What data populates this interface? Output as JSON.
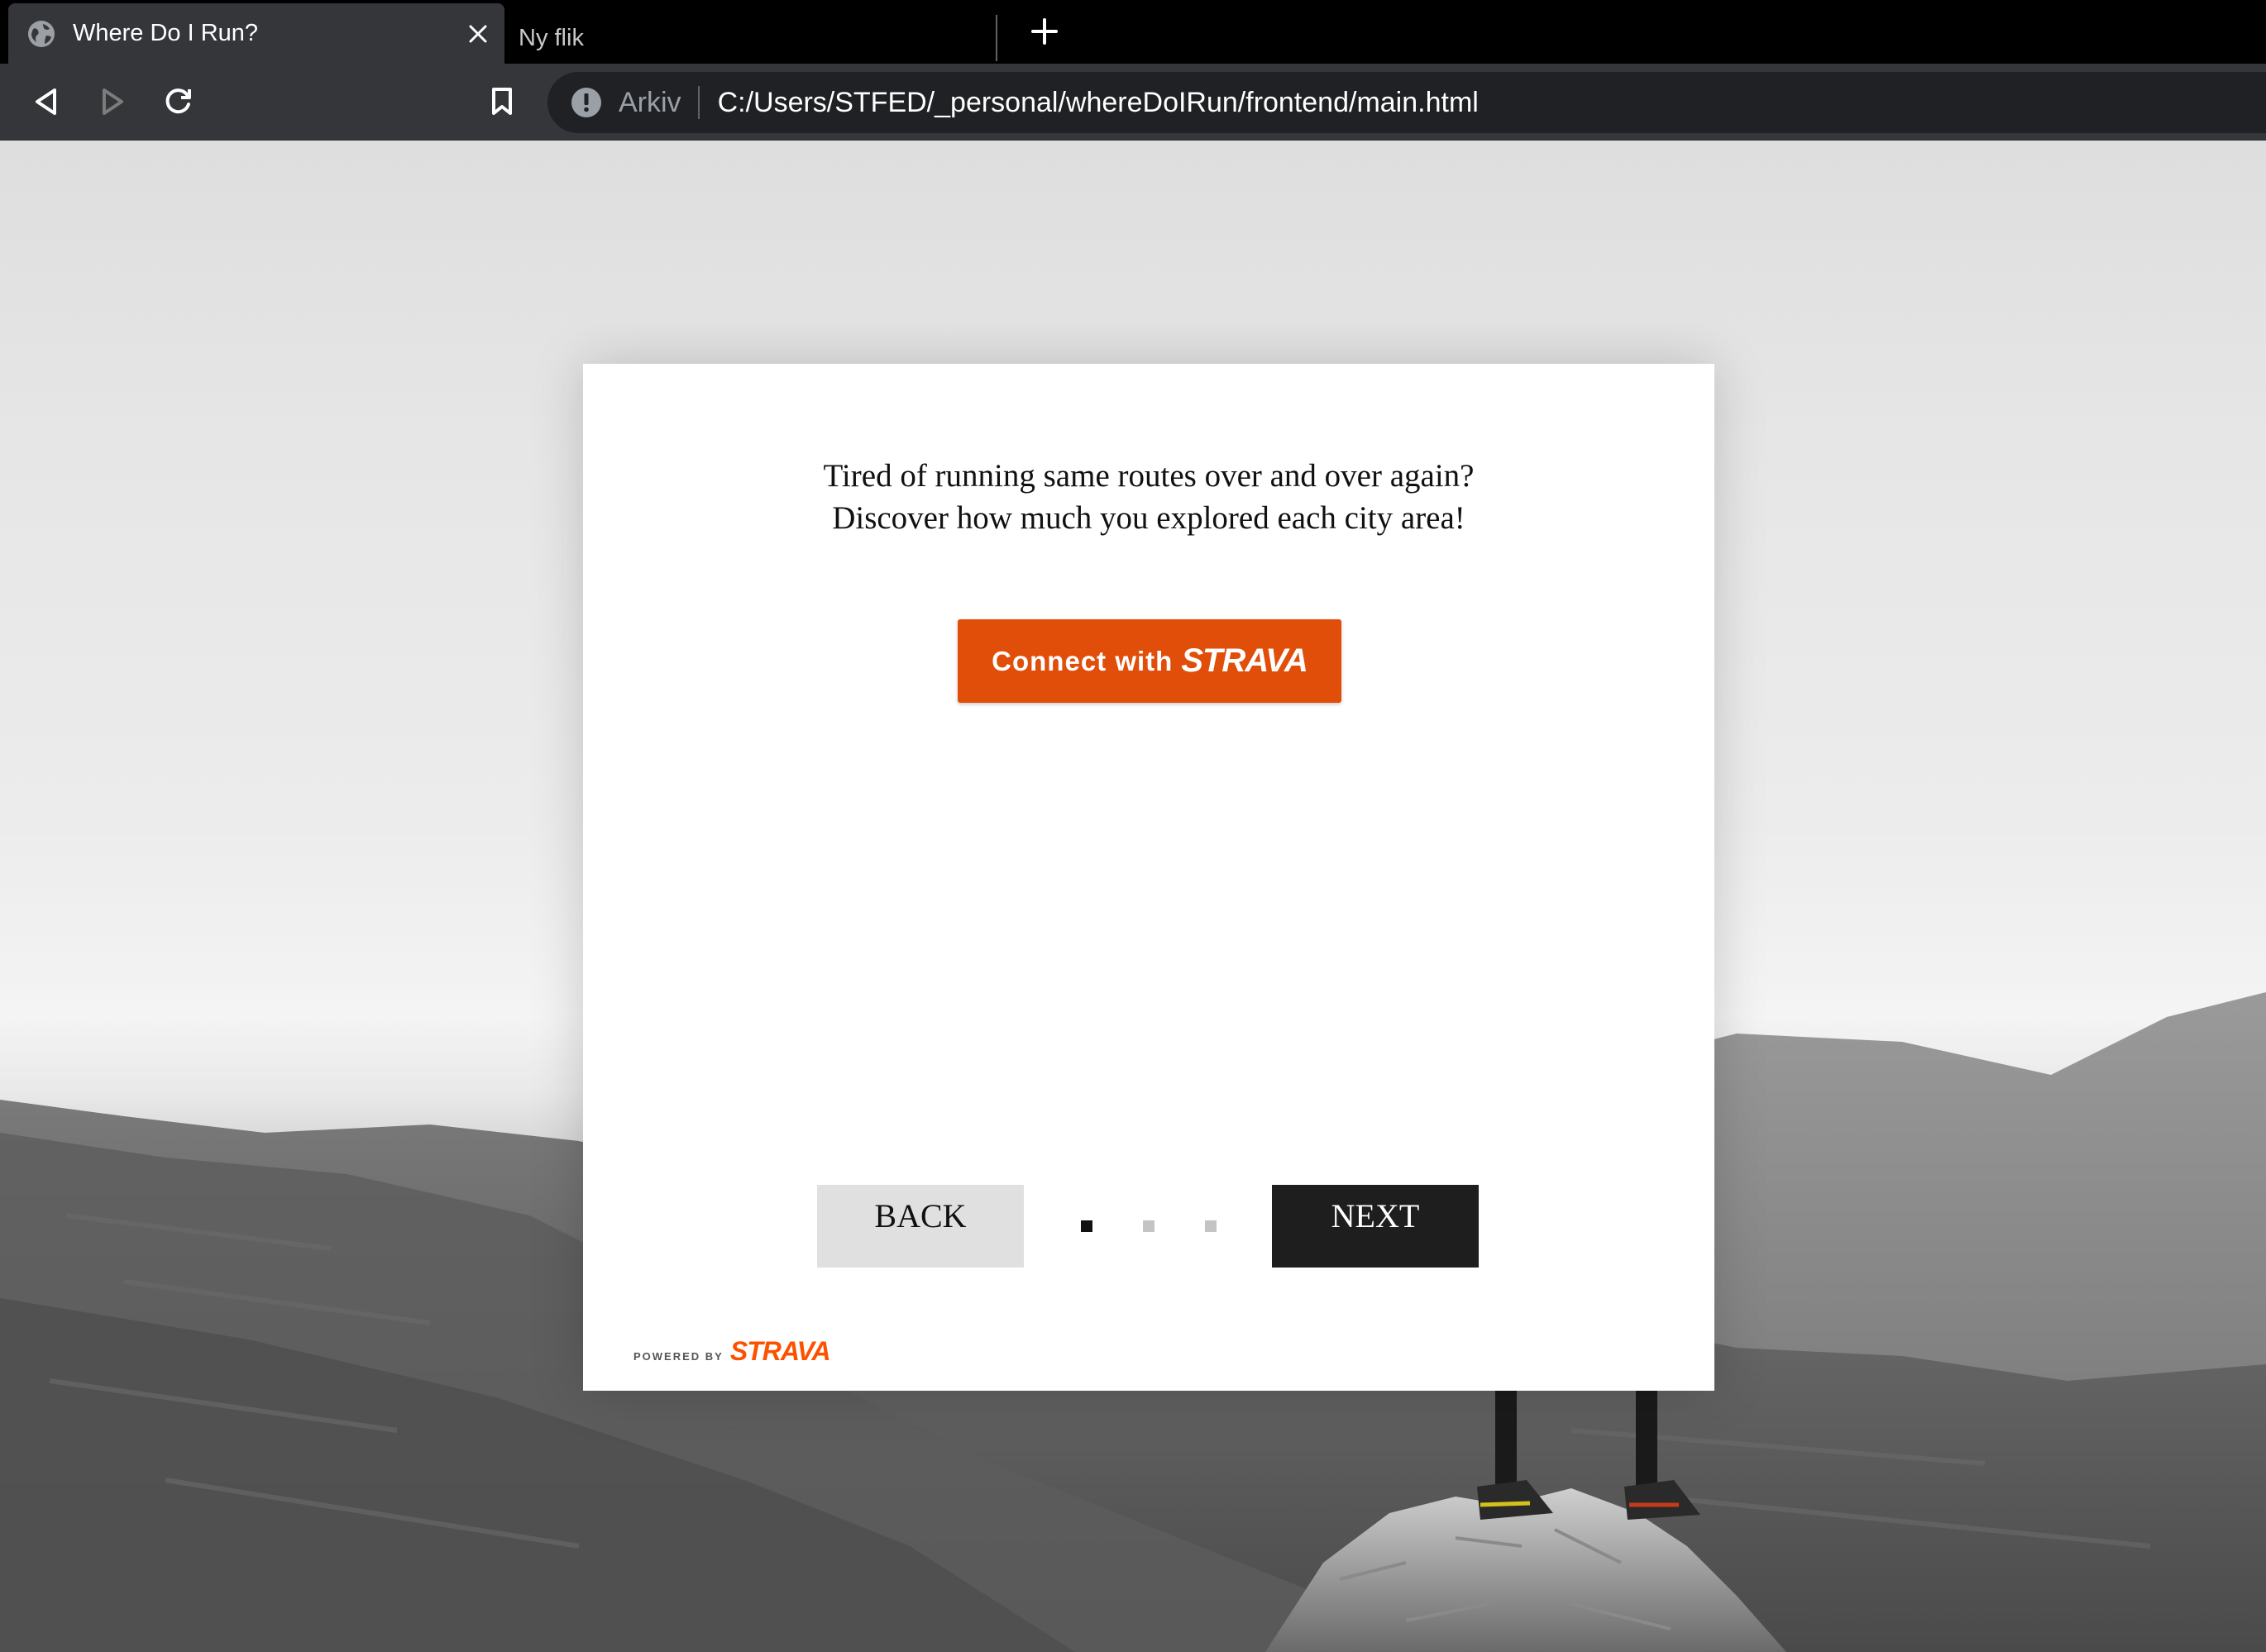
{
  "browser": {
    "tabs": [
      {
        "title": "Where Do I Run?",
        "active": true,
        "favicon": "globe-icon"
      },
      {
        "title": "Ny flik",
        "active": false
      }
    ],
    "new_tab_icon": "plus-icon",
    "toolbar": {
      "back_icon": "back-arrow-icon",
      "forward_icon": "forward-arrow-icon",
      "reload_icon": "reload-icon",
      "bookmark_icon": "bookmark-icon"
    },
    "address_bar": {
      "security_icon": "info-icon",
      "scheme_label": "Arkiv",
      "url": "C:/Users/STFED/_personal/whereDoIRun/frontend/main.html"
    }
  },
  "page": {
    "intro_line1": "Tired of running same routes over and over again?",
    "intro_line2": "Discover how much you explored each city area!",
    "connect_button": {
      "label": "Connect with",
      "brand": "STRAVA"
    },
    "back_label": "BACK",
    "next_label": "NEXT",
    "pager": {
      "total": 3,
      "current": 1
    },
    "powered": {
      "label": "POWERED BY",
      "brand": "STRAVA"
    }
  },
  "colors": {
    "strava_orange": "#e04e0a",
    "powered_orange": "#fc5200",
    "next_button": "#1e1e1e",
    "back_button": "#e0e0e0",
    "tab_active": "#35363a",
    "tabstrip": "#000000"
  }
}
